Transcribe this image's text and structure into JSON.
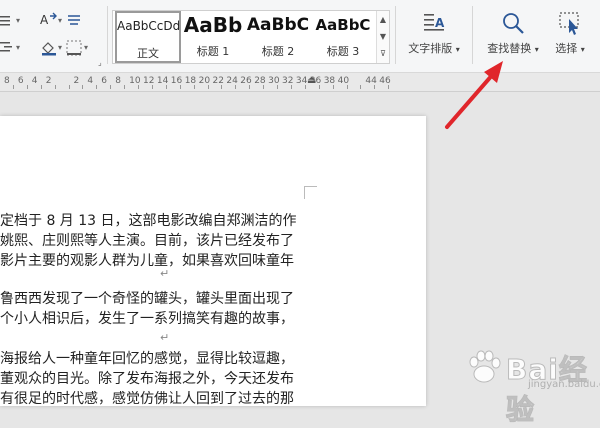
{
  "ribbon": {
    "styles": [
      {
        "preview": "AaBbCcDd",
        "name": "正文"
      },
      {
        "preview": "AaBb",
        "name": "标题 1"
      },
      {
        "preview": "AaBbC",
        "name": "标题 2"
      },
      {
        "preview": "AaBbC",
        "name": "标题 3"
      }
    ],
    "text_layout_label": "文字排版",
    "find_replace_label": "查找替换",
    "select_label": "选择"
  },
  "ruler": {
    "numbers": [
      "8",
      "6",
      "4",
      "2",
      "",
      "2",
      "4",
      "6",
      "8",
      "10",
      "12",
      "14",
      "16",
      "18",
      "20",
      "22",
      "24",
      "26",
      "28",
      "30",
      "32",
      "34",
      "36",
      "38",
      "40",
      "",
      "44",
      "46"
    ]
  },
  "document": {
    "lines": [
      "定档于 8 月 13 日，这部电影改编自郑渊洁的作",
      "姚熙、庄则熙等人主演。目前，该片已经发布了",
      "影片主要的观影人群为儿童，如果喜欢回味童年",
      "",
      "鲁西西发现了一个奇怪的罐头，罐头里面出现了",
      "个小人相识后，发生了一系列搞笑有趣的故事，",
      "",
      "海报给人一种童年回忆的感觉，显得比较逗趣，",
      "董观众的目光。除了发布海报之外，今天还发布",
      "有很足的时代感，感觉仿佛让人回到了过去的那"
    ]
  },
  "watermark": {
    "text": "Bai经验",
    "sub": "jingyan.baidu.com"
  },
  "colors": {
    "arrow": "#e0262b",
    "accent": "#2b5797"
  }
}
